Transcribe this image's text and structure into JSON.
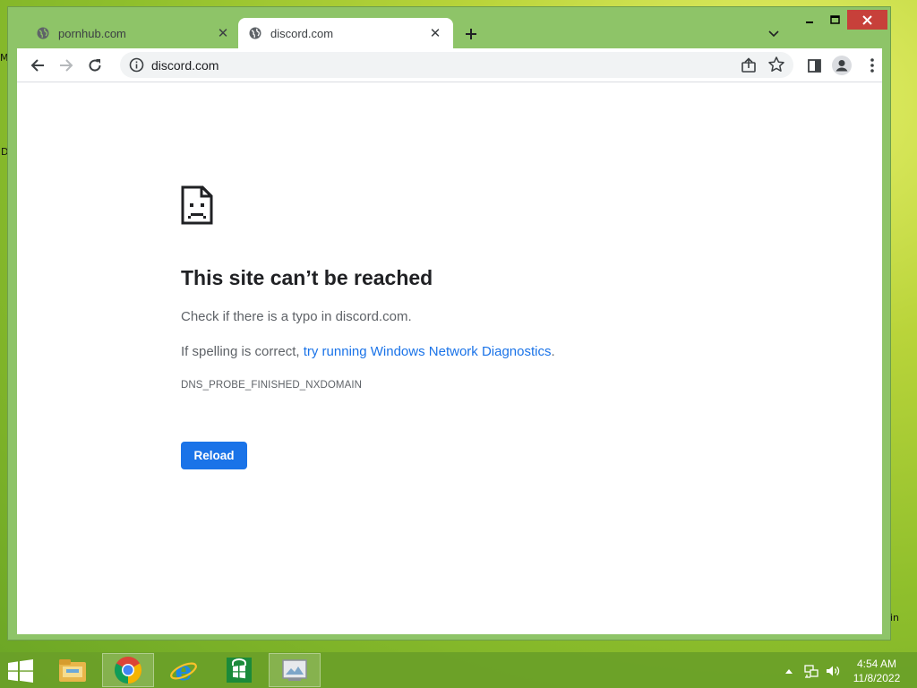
{
  "desktop": {
    "frag_top": "M",
    "frag_mid": "D",
    "frag_bottom": "in"
  },
  "tabs": [
    {
      "label": "pornhub.com",
      "active": false,
      "icon": "globe-icon"
    },
    {
      "label": "discord.com",
      "active": true,
      "icon": "globe-icon"
    }
  ],
  "tab_close_glyph": "✕",
  "addressbar": {
    "url": "discord.com"
  },
  "error": {
    "heading": "This site can’t be reached",
    "line1": "Check if there is a typo in discord.com.",
    "line2_prefix": "If spelling is correct, ",
    "line2_link": "try running Windows Network Diagnostics",
    "line2_suffix": ".",
    "code": "DNS_PROBE_FINISHED_NXDOMAIN",
    "button": "Reload"
  },
  "taskbar": {
    "apps": [
      "file-explorer-icon",
      "chrome-icon",
      "internet-explorer-icon",
      "store-icon",
      "photo-viewer-icon"
    ],
    "time": "4:54 AM",
    "date": "11/8/2022"
  },
  "colors": {
    "accent": "#1a73e8",
    "window_frame": "#8ec468",
    "close_button": "#c7403a",
    "taskbar": "#6aa028"
  }
}
